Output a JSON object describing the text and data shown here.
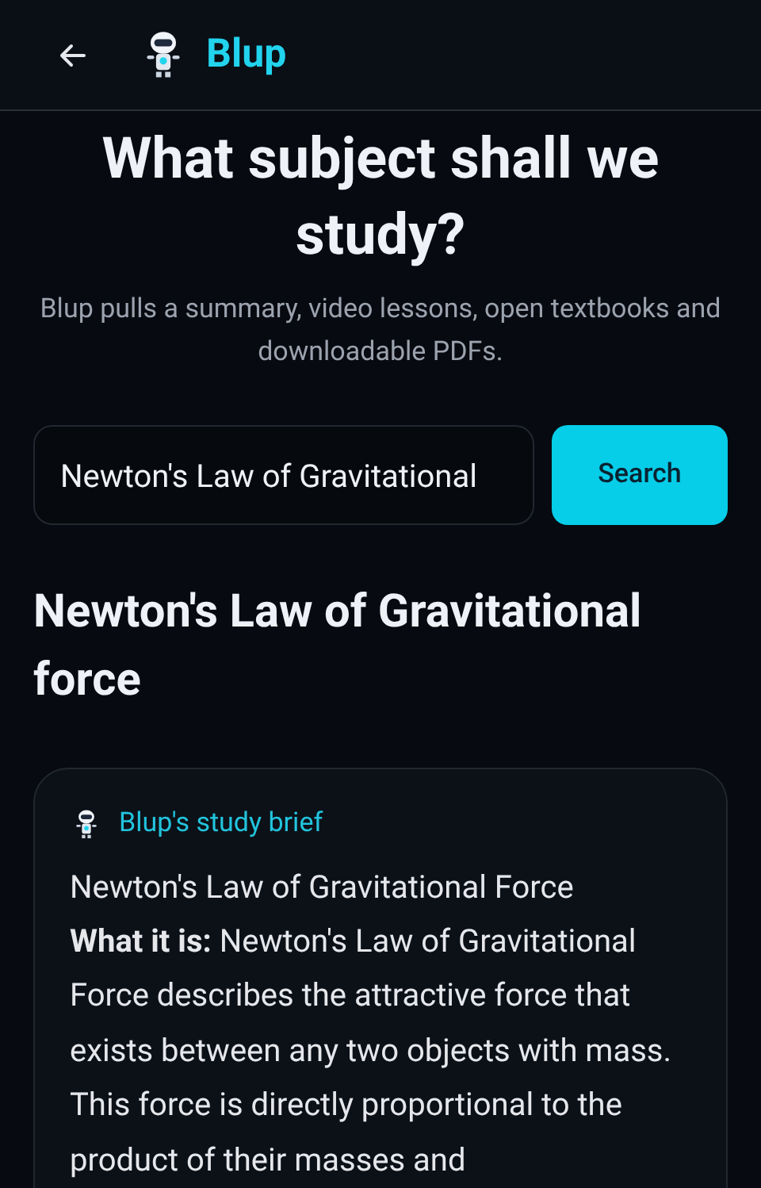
{
  "header": {
    "brand": "Blup"
  },
  "hero": {
    "title": "What subject shall we study?",
    "subtitle": "Blup pulls a summary, video lessons, open textbooks and downloadable PDFs."
  },
  "search": {
    "value": "Newton's Law of Gravitational",
    "button": "Search"
  },
  "topic": {
    "title": "Newton's Law of Gravitational force"
  },
  "brief": {
    "label": "Blup's study brief",
    "heading": "Newton's Law of Gravitational Force",
    "body": "**What it is:** Newton's Law of Gravitational Force describes the attractive force that exists between any two objects with mass. This force is directly proportional to the product of their masses and"
  }
}
